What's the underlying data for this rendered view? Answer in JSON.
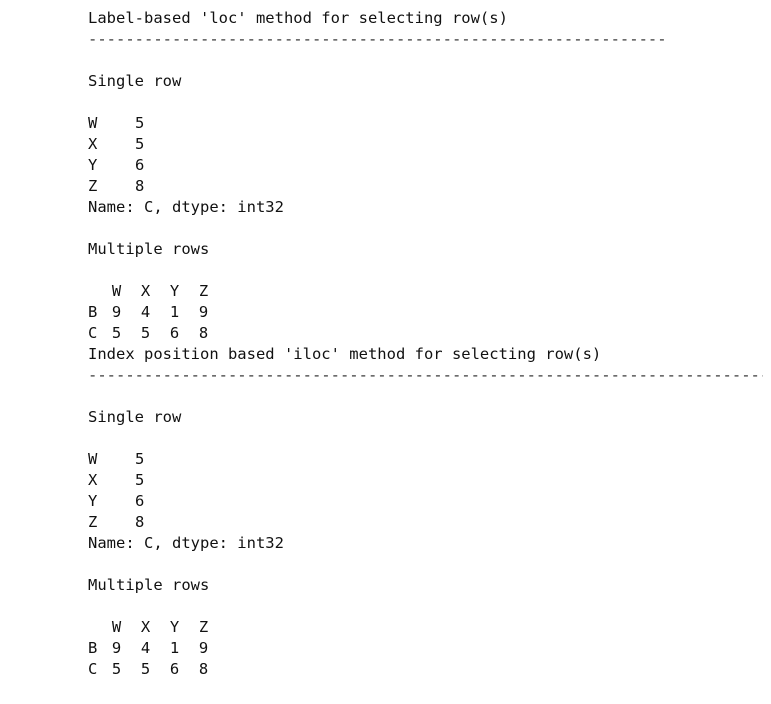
{
  "sections": [
    {
      "title": "Label-based 'loc' method for selecting row(s)",
      "rule": "--------------------------------------------------------------",
      "single_label": "Single row",
      "series": [
        {
          "index": "W",
          "value": "5"
        },
        {
          "index": "X",
          "value": "5"
        },
        {
          "index": "Y",
          "value": "6"
        },
        {
          "index": "Z",
          "value": "8"
        }
      ],
      "series_footer": "Name: C, dtype: int32",
      "multiple_label": "Multiple rows",
      "df_columns": [
        "W",
        "X",
        "Y",
        "Z"
      ],
      "df_rows": [
        {
          "index": "B",
          "values": [
            "9",
            "4",
            "1",
            "9"
          ]
        },
        {
          "index": "C",
          "values": [
            "5",
            "5",
            "6",
            "8"
          ]
        }
      ]
    },
    {
      "title": "Index position based 'iloc' method for selecting row(s)",
      "rule": "----------------------------------------------------------------------------",
      "single_label": "Single row",
      "series": [
        {
          "index": "W",
          "value": "5"
        },
        {
          "index": "X",
          "value": "5"
        },
        {
          "index": "Y",
          "value": "6"
        },
        {
          "index": "Z",
          "value": "8"
        }
      ],
      "series_footer": "Name: C, dtype: int32",
      "multiple_label": "Multiple rows",
      "df_columns": [
        "W",
        "X",
        "Y",
        "Z"
      ],
      "df_rows": [
        {
          "index": "B",
          "values": [
            "9",
            "4",
            "1",
            "9"
          ]
        },
        {
          "index": "C",
          "values": [
            "5",
            "5",
            "6",
            "8"
          ]
        }
      ]
    }
  ]
}
